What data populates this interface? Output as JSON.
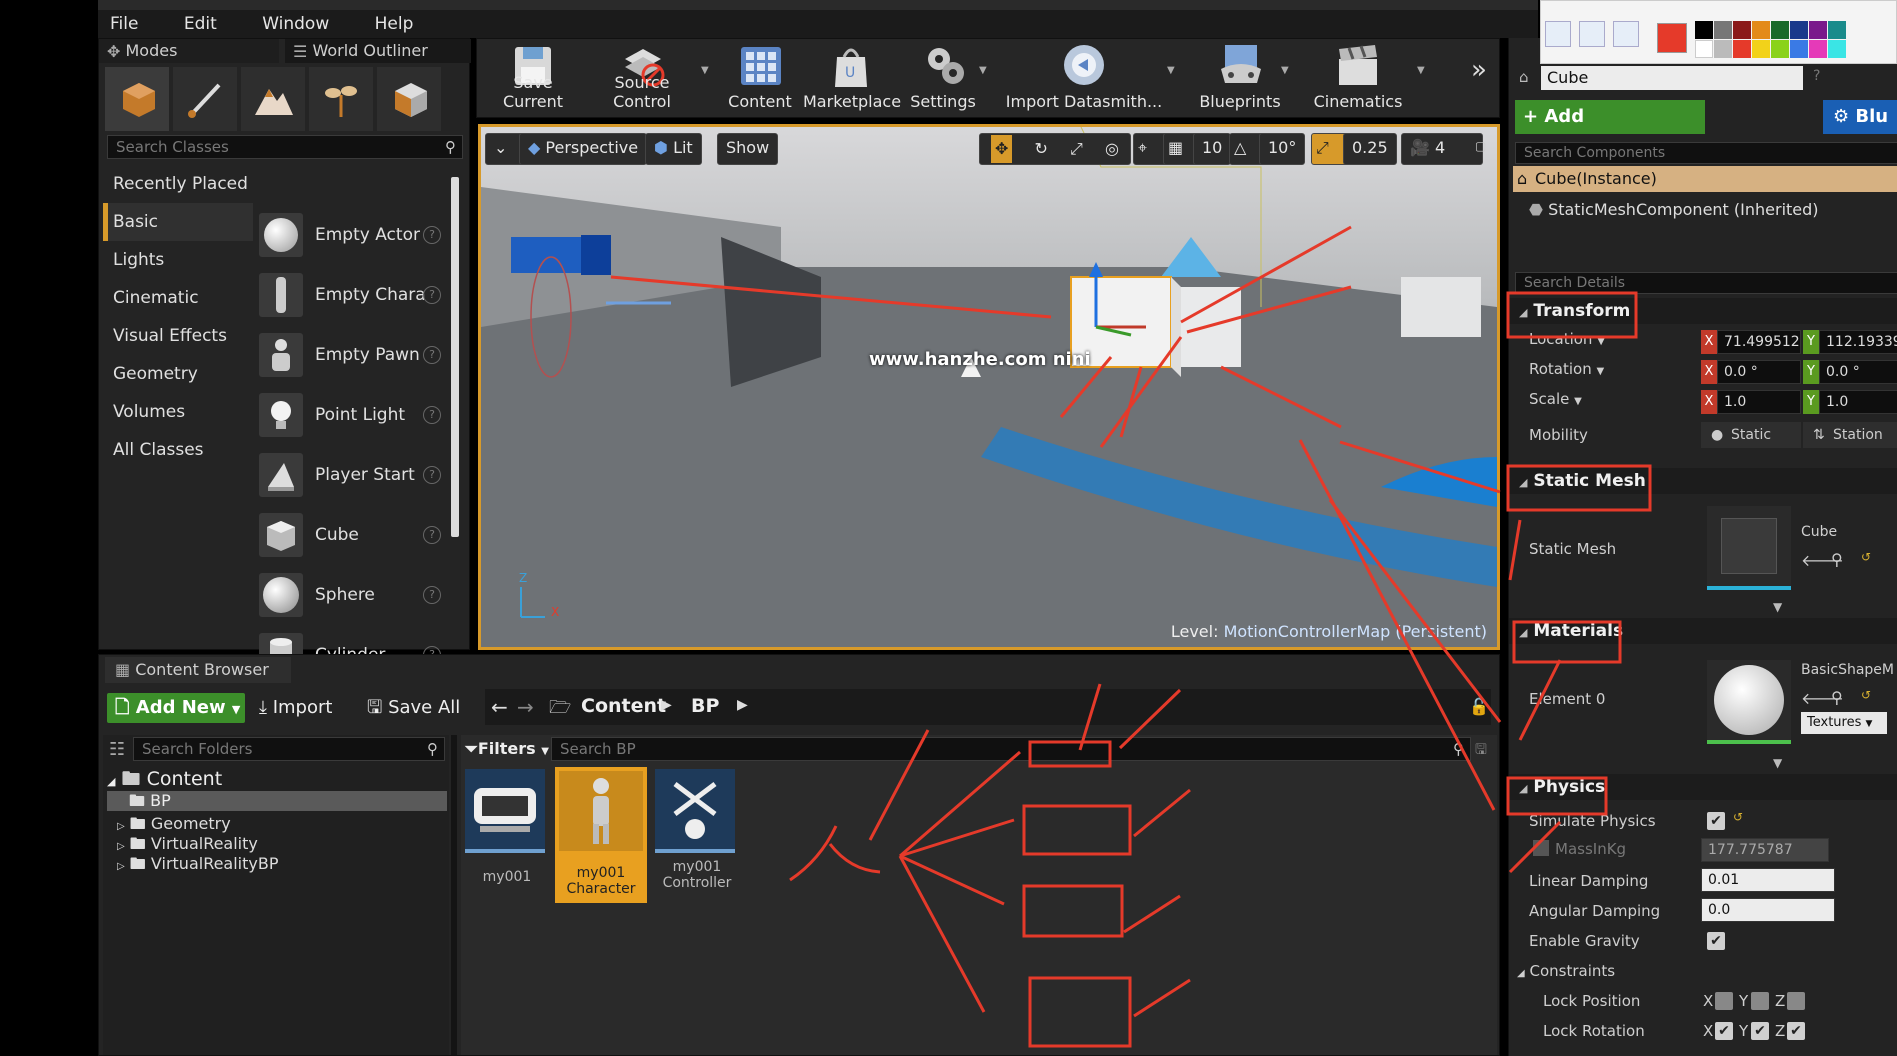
{
  "menu": [
    "File",
    "Edit",
    "Window",
    "Help"
  ],
  "modes": {
    "tab_label": "Modes",
    "search_placeholder": "Search Classes",
    "categories": [
      "Recently Placed",
      "Basic",
      "Lights",
      "Cinematic",
      "Visual Effects",
      "Geometry",
      "Volumes",
      "All Classes"
    ],
    "active_category": "Basic",
    "actors": [
      "Empty Actor",
      "Empty Chara",
      "Empty Pawn",
      "Point Light",
      "Player Start",
      "Cube",
      "Sphere",
      "Cylinder"
    ]
  },
  "world_outliner": {
    "tab_label": "World Outliner"
  },
  "toolbar": {
    "buttons": [
      "Save Current",
      "Source Control",
      "Content",
      "Marketplace",
      "Settings",
      "Import Datasmith...",
      "Blueprints",
      "Cinematics"
    ]
  },
  "viewport": {
    "perspective_label": "Perspective",
    "lit_label": "Lit",
    "show_label": "Show",
    "grid_snap": "10",
    "rotation_snap": "10°",
    "scale_snap": "0.25",
    "camera_speed": "4",
    "watermark": "www.hanzhe.com nini",
    "level_prefix": "Level:",
    "level_name": "MotionControllerMap (Persistent)"
  },
  "content_browser": {
    "tab_label": "Content Browser",
    "add_new": "Add New",
    "import": "Import",
    "save_all": "Save All",
    "path": [
      "Content",
      "BP"
    ],
    "search_folders_placeholder": "Search Folders",
    "filters_label": "Filters",
    "search_assets_placeholder": "Search BP",
    "folders": {
      "root": "Content",
      "children": [
        "BP",
        "Geometry",
        "VirtualReality",
        "VirtualRealityBP"
      ],
      "selected": "BP"
    },
    "assets": [
      {
        "line1": "my001",
        "line2": ""
      },
      {
        "line1": "my001",
        "line2": "Character"
      },
      {
        "line1": "my001",
        "line2": "Controller"
      }
    ]
  },
  "details": {
    "actor_name": "Cube",
    "add_component": "Add Component",
    "blueprint_btn": "Blu",
    "search_components_placeholder": "Search Components",
    "root_component": "Cube(Instance)",
    "child_component": "StaticMeshComponent (Inherited)",
    "search_details_placeholder": "Search Details",
    "transform": {
      "title": "Transform",
      "location_label": "Location",
      "location_x": "71.499512",
      "location_y": "112.19339",
      "rotation_label": "Rotation",
      "rotation_x": "0.0 °",
      "rotation_y": "0.0 °",
      "scale_label": "Scale",
      "scale_x": "1.0",
      "scale_y": "1.0",
      "mobility_label": "Mobility",
      "mobility_static": "Static",
      "mobility_stationary": "Station"
    },
    "static_mesh": {
      "title": "Static Mesh",
      "label": "Static Mesh",
      "value": "Cube"
    },
    "materials": {
      "title": "Materials",
      "label": "Element 0",
      "value": "BasicShapeM",
      "textures": "Textures"
    },
    "physics": {
      "title": "Physics",
      "simulate": "Simulate Physics",
      "mass_label": "MassInKg",
      "mass_value": "177.775787",
      "linear_damping_label": "Linear Damping",
      "linear_damping": "0.01",
      "angular_damping_label": "Angular Damping",
      "angular_damping": "0.0",
      "gravity_label": "Enable Gravity",
      "constraints_label": "Constraints",
      "lock_position": "Lock Position",
      "lock_rotation": "Lock Rotation",
      "x": "X",
      "y": "Y",
      "z": "Z"
    }
  },
  "colors": {
    "accent_orange": "#d79a2a",
    "add_green": "#3c8f2a",
    "annotation_red": "#e53a2a",
    "selection_blue": "#1a5fb4"
  }
}
